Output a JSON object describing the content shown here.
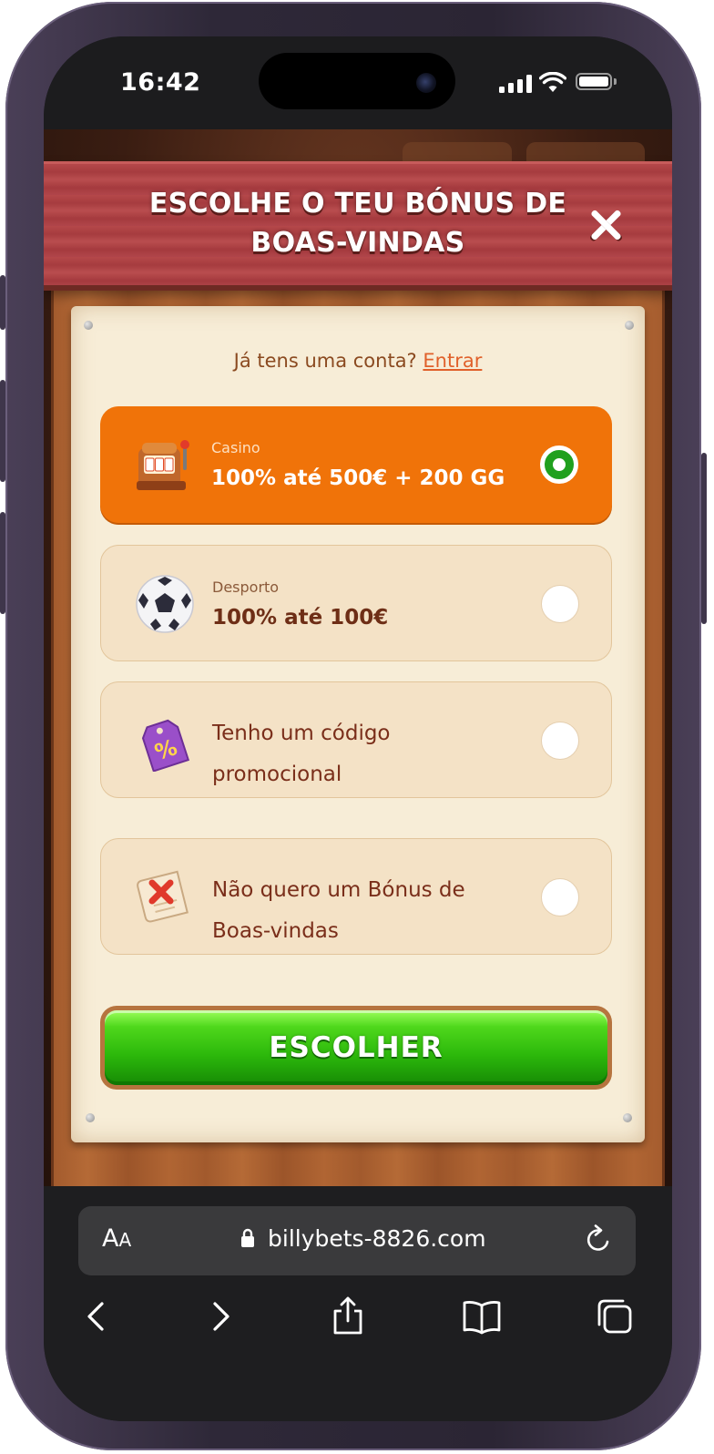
{
  "status_bar": {
    "time": "16:42"
  },
  "modal": {
    "title": "ESCOLHE O TEU BÓNUS DE BOAS-VINDAS",
    "login_prompt": "Já tens uma conta?",
    "login_link": "Entrar",
    "options": [
      {
        "label": "Casino",
        "value": "100% até 500€ + 200 GG",
        "icon": "slot-machine-icon",
        "selected": true
      },
      {
        "label": "Desporto",
        "value": "100% até 100€",
        "icon": "soccer-ball-icon",
        "selected": false
      },
      {
        "text_line1": "Tenho um código",
        "text_line2": "promocional",
        "icon": "percent-tag-icon",
        "selected": false
      },
      {
        "text_line1": "Não quero um Bónus de",
        "text_line2": "Boas-vindas",
        "icon": "no-bonus-scroll-icon",
        "selected": false
      }
    ],
    "choose_button": "ESCOLHER",
    "colors": {
      "selected_option": "#f07309",
      "radio_selected": "#20a01e",
      "button_green": "#2cb80b",
      "header_red": "#b0454a"
    }
  },
  "browser": {
    "text_size_button": "AA",
    "url": "billybets-8826.com"
  }
}
